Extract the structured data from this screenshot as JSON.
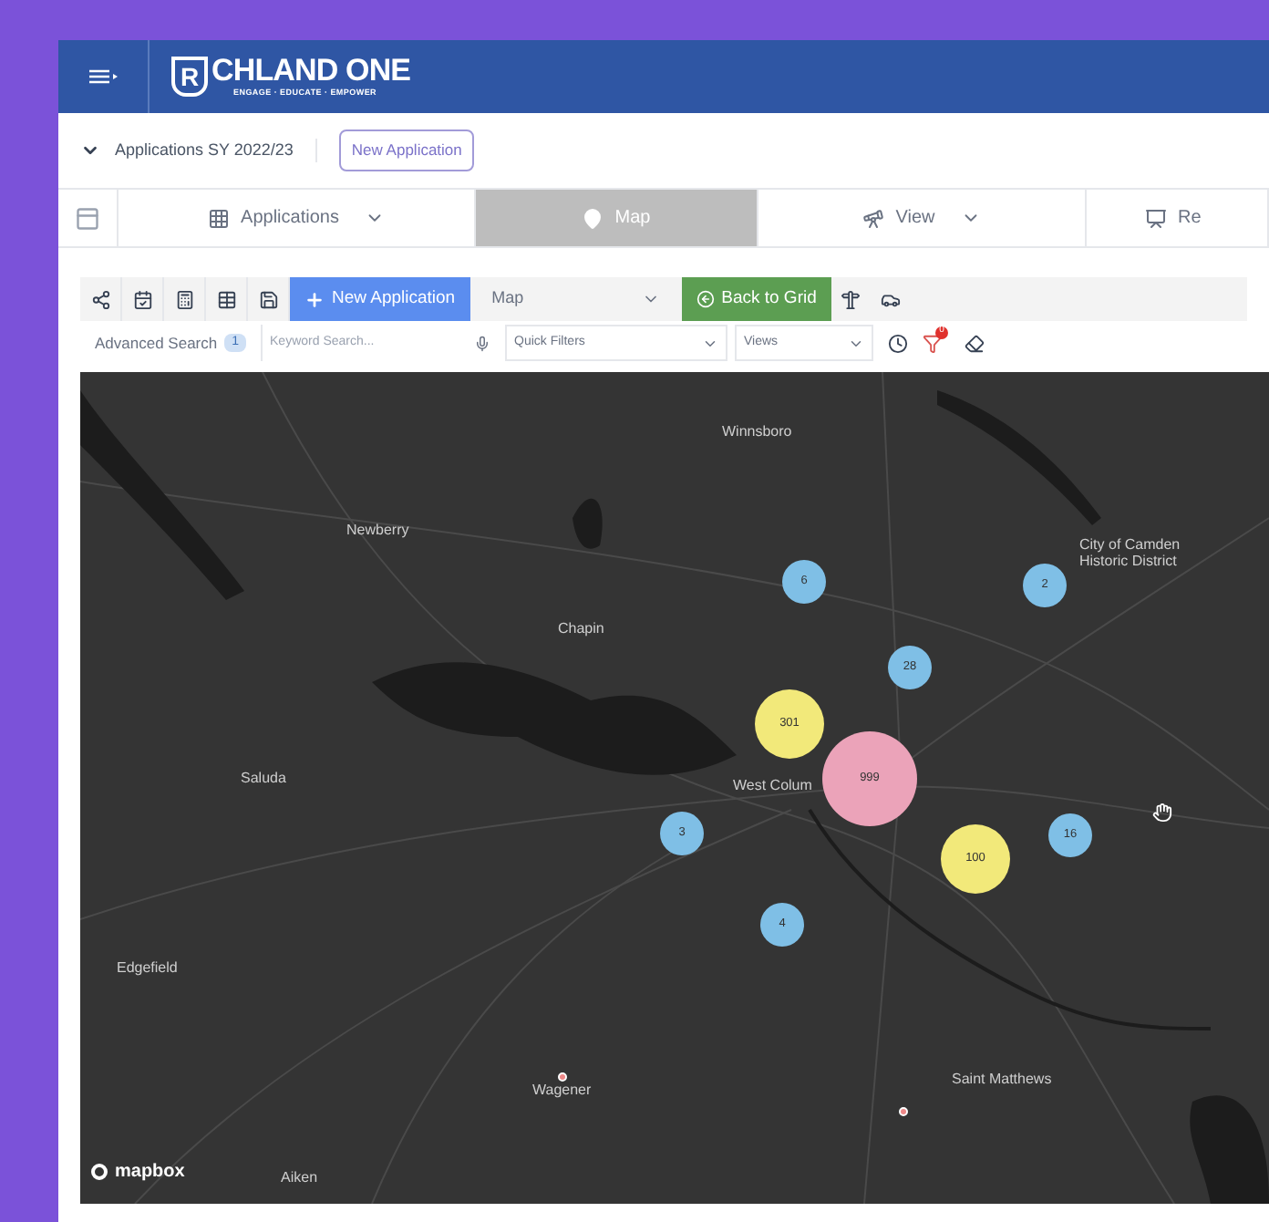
{
  "header": {
    "logo_letter": "R",
    "logo_text": "CHLAND ONE",
    "tagline": "ENGAGE · EDUCATE · EMPOWER"
  },
  "subheader": {
    "title": "Applications SY 2022/23",
    "button": "New Application"
  },
  "tabs": [
    {
      "label": "Applications",
      "kind": "dropdown",
      "selected": false
    },
    {
      "label": "Map",
      "kind": "plain",
      "selected": true
    },
    {
      "label": "View",
      "kind": "dropdown",
      "selected": false
    },
    {
      "label": "Re",
      "kind": "plain",
      "selected": false
    }
  ],
  "toolbar": {
    "new_button": "New Application",
    "view_select": "Map",
    "back_button": "Back to Grid"
  },
  "search_row": {
    "label": "Advanced Search",
    "count": "1",
    "keyword_placeholder": "Keyword Search...",
    "quick_filters": "Quick Filters",
    "views": "Views",
    "filter_badge": "0"
  },
  "map": {
    "places": [
      {
        "name": "Winnsboro"
      },
      {
        "name": "Newberry"
      },
      {
        "name": "City of Camden Historic District"
      },
      {
        "name": "Chapin"
      },
      {
        "name": "Saluda"
      },
      {
        "name": "West Colum"
      },
      {
        "name": "Edgefield"
      },
      {
        "name": "Wagener"
      },
      {
        "name": "Saint Matthews"
      },
      {
        "name": "Aiken"
      }
    ],
    "clusters": [
      {
        "count": "6",
        "color": "#7fbfe6"
      },
      {
        "count": "2",
        "color": "#7fbfe6"
      },
      {
        "count": "28",
        "color": "#7fbfe6"
      },
      {
        "count": "301",
        "color": "#f2e97a"
      },
      {
        "count": "999",
        "color": "#eba3b9"
      },
      {
        "count": "3",
        "color": "#7fbfe6"
      },
      {
        "count": "100",
        "color": "#f2e97a"
      },
      {
        "count": "16",
        "color": "#7fbfe6"
      },
      {
        "count": "4",
        "color": "#7fbfe6"
      }
    ],
    "attribution": "mapbox"
  }
}
